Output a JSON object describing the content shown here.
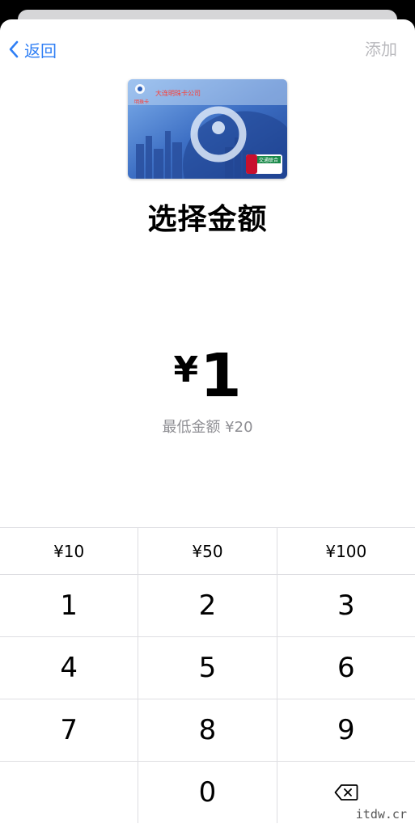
{
  "nav": {
    "back_label": "返回",
    "add_label": "添加"
  },
  "card": {
    "issuer_text": "大连明珠卡公司",
    "card_name": "明珠卡",
    "badge_text": "交通联合",
    "colors": {
      "primary": "#2d5fb8",
      "secondary": "#6fa0e0",
      "badge": "#c8102e"
    }
  },
  "title": "选择金额",
  "amount": {
    "currency": "¥",
    "value": "1"
  },
  "min_amount_text": "最低金额 ¥20",
  "keypad": {
    "presets": [
      "¥10",
      "¥50",
      "¥100"
    ],
    "rows": [
      [
        "1",
        "2",
        "3"
      ],
      [
        "4",
        "5",
        "6"
      ],
      [
        "7",
        "8",
        "9"
      ]
    ],
    "zero": "0",
    "delete_icon": "backspace-icon"
  },
  "watermark": "itdw.cr",
  "colors": {
    "accent": "#2f7ff5",
    "disabled": "#b9b9bd",
    "secondary_text": "#8e8e93",
    "divider": "#dedee2"
  }
}
